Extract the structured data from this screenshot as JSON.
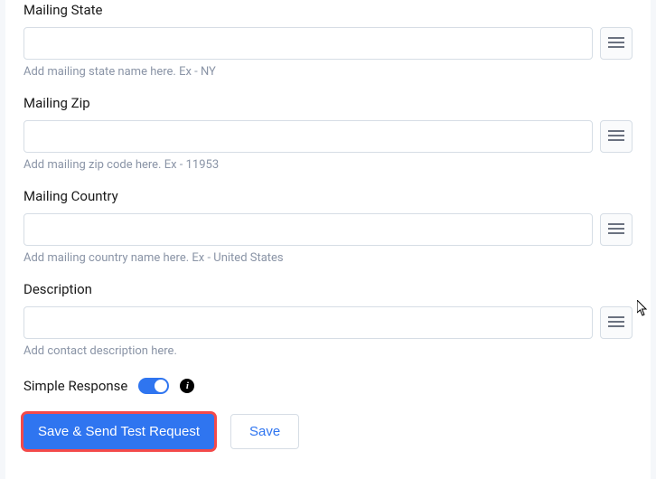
{
  "fields": {
    "mailing_state": {
      "label": "Mailing State",
      "value": "",
      "help": "Add mailing state name here. Ex - NY"
    },
    "mailing_zip": {
      "label": "Mailing Zip",
      "value": "",
      "help": "Add mailing zip code here. Ex - 11953"
    },
    "mailing_country": {
      "label": "Mailing Country",
      "value": "",
      "help": "Add mailing country name here. Ex - United States"
    },
    "description": {
      "label": "Description",
      "value": "",
      "help": "Add contact description here."
    }
  },
  "simple_response": {
    "label": "Simple Response",
    "enabled": true
  },
  "buttons": {
    "save_send": "Save & Send Test Request",
    "save": "Save"
  }
}
